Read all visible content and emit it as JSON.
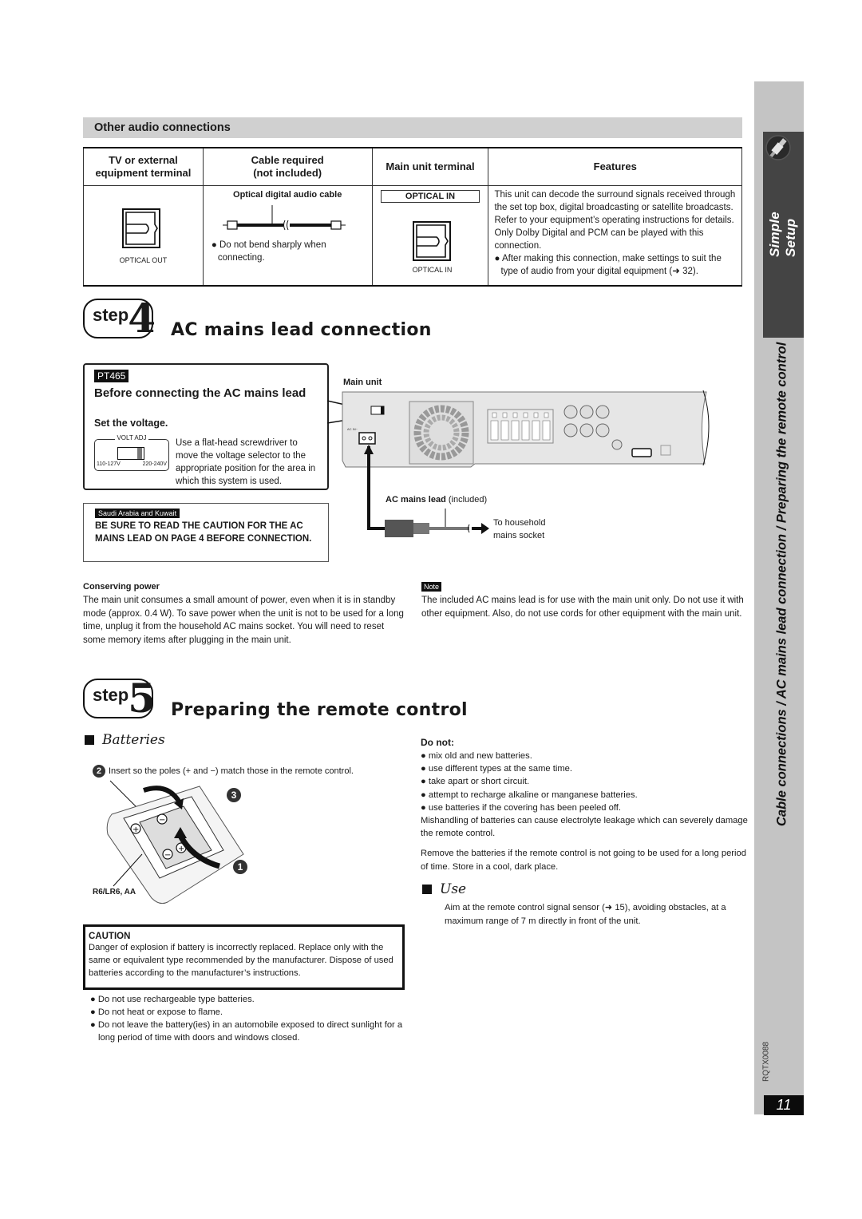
{
  "side_tab": {
    "section": "Simple Setup",
    "running_title": "Cable connections / AC mains lead connection / Preparing the remote control",
    "doc_code": "RQTX0088",
    "page_number": "11"
  },
  "other_audio": {
    "title": "Other audio connections",
    "headers": [
      "TV or external equipment terminal",
      "Cable required (not included)",
      "Main unit terminal",
      "Features"
    ],
    "header_lines": {
      "col1": [
        "TV or external",
        "equipment terminal"
      ],
      "col2": [
        "Cable required",
        "(not included)"
      ],
      "col3": "Main unit terminal",
      "col4": "Features"
    },
    "row": {
      "tv_terminal_label": "OPTICAL OUT",
      "cable_name": "Optical digital audio cable",
      "cable_note": "Do not bend sharply when connecting.",
      "main_terminal_box": "OPTICAL IN",
      "main_terminal_label": "OPTICAL IN",
      "features_text": "This unit can decode the surround signals received through the set top box, digital broadcasting or satellite broadcasts. Refer to your equipment’s operating instructions for details. Only Dolby Digital and PCM can be played with this connection.",
      "features_bullet": "After making this connection, make settings to suit the type of audio from your digital equipment (➜ 32)."
    }
  },
  "step4": {
    "step_word": "step",
    "step_number": "4",
    "title": "AC mains lead connection",
    "model_badge": "PT465",
    "box_heading": "Before connecting the AC mains lead",
    "box_subheading": "Set the voltage.",
    "volt_label": "VOLT ADJ",
    "volt_low": "110-127V",
    "volt_high": "220-240V",
    "box_desc": "Use a flat-head screwdriver to move the voltage selector to the appropriate position for the area in which this system is used.",
    "region_badge": "Saudi Arabia and Kuwait",
    "region_warning": "BE SURE TO READ THE CAUTION FOR THE AC MAINS LEAD ON PAGE 4 BEFORE CONNECTION.",
    "diagram": {
      "main_unit_label": "Main unit",
      "ac_in_label": "AC IN~",
      "lead_label_bold": "AC mains lead",
      "lead_label_rest": " (included)",
      "socket_label": "To household mains socket"
    },
    "conserving": {
      "heading": "Conserving power",
      "text": "The main unit consumes a small amount of power, even when it is in standby mode (approx. 0.4 W). To save power when the unit is not to be used for a long time, unplug it from the household AC mains socket. You will need to reset some memory items after plugging in the main unit."
    },
    "note": {
      "badge": "Note",
      "text": "The included AC mains lead is for use with the main unit only. Do not use it with other equipment. Also, do not use cords for other equipment with the main unit."
    }
  },
  "step5": {
    "step_word": "step",
    "step_number": "5",
    "title": "Preparing the remote control",
    "batteries": {
      "heading": "Batteries",
      "instruction_num": "2",
      "instruction": "Insert so the poles (+ and −) match those in the remote control.",
      "step_markers": [
        "1",
        "3"
      ],
      "battery_type": "R6/LR6, AA"
    },
    "do_not": {
      "heading": "Do not:",
      "items": [
        "mix old and new batteries.",
        "use different types at the same time.",
        "take apart or short circuit.",
        "attempt to recharge alkaline or manganese batteries.",
        "use batteries if the covering has been peeled off."
      ],
      "mishandling": "Mishandling of batteries can cause electrolyte leakage which can severely damage the remote control.",
      "remove": "Remove the batteries if the remote control is not going to be used for a long period of time. Store in a cool, dark place."
    },
    "use": {
      "heading": "Use",
      "text": "Aim at the remote control signal sensor (➜ 15), avoiding obstacles, at a maximum range of 7 m directly in front of the unit."
    },
    "caution": {
      "heading": "CAUTION",
      "text": "Danger of explosion if battery is incorrectly replaced. Replace only with the same or equivalent type recommended by the manufacturer. Dispose of used batteries according to the manufacturer’s instructions."
    },
    "bullets": [
      "Do not use rechargeable type batteries.",
      "Do not heat or expose to flame.",
      "Do not leave the battery(ies) in an automobile exposed to direct sunlight for a long period of time with doors and windows closed."
    ]
  }
}
